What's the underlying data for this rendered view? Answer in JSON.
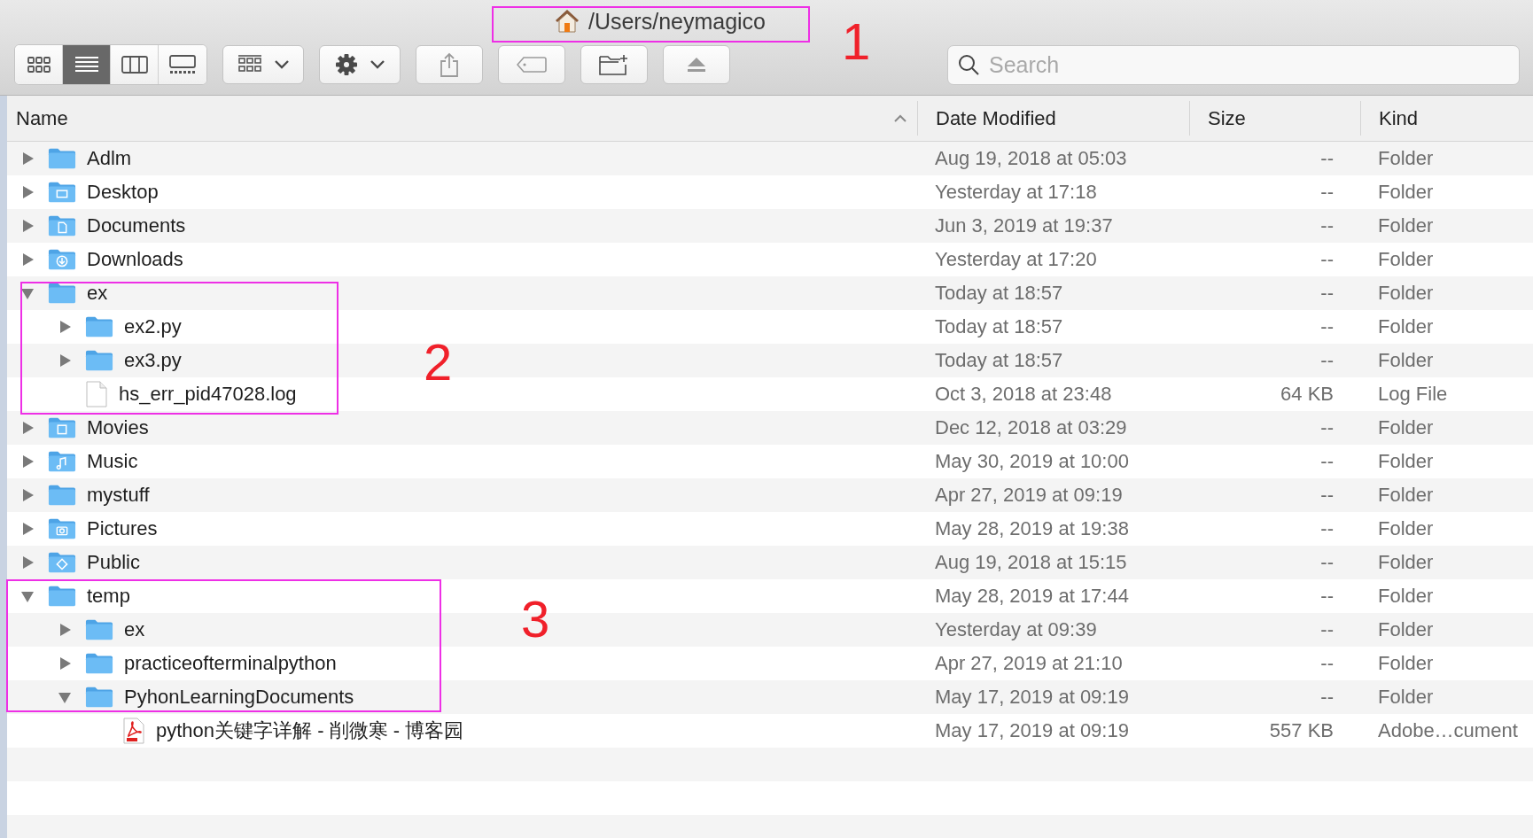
{
  "window": {
    "title": "/Users/neymagico"
  },
  "toolbar": {
    "view_modes": [
      {
        "kind": "icons",
        "selected": false
      },
      {
        "kind": "list",
        "selected": true
      },
      {
        "kind": "columns",
        "selected": false
      },
      {
        "kind": "gallery",
        "selected": false
      }
    ],
    "search": {
      "placeholder": "Search"
    }
  },
  "table": {
    "columns": [
      {
        "label": "Name",
        "sorted": true
      },
      {
        "label": "Date Modified",
        "sorted": false
      },
      {
        "label": "Size",
        "sorted": false
      },
      {
        "label": "Kind",
        "sorted": false
      }
    ],
    "rows": [
      {
        "name": "Adlm",
        "kind": "folder",
        "expanded": false,
        "date": "Aug 19, 2018 at 05:03",
        "size": "--",
        "type": "Folder"
      },
      {
        "name": "Desktop",
        "kind": "desktop",
        "expanded": false,
        "date": "Yesterday at 17:18",
        "size": "--",
        "type": "Folder"
      },
      {
        "name": "Documents",
        "kind": "documents",
        "expanded": false,
        "date": "Jun 3, 2019 at 19:37",
        "size": "--",
        "type": "Folder"
      },
      {
        "name": "Downloads",
        "kind": "downloads",
        "expanded": false,
        "date": "Yesterday at 17:20",
        "size": "--",
        "type": "Folder"
      },
      {
        "name": "ex",
        "kind": "folder",
        "expanded": true,
        "date": "Today at 18:57",
        "size": "--",
        "type": "Folder",
        "children": [
          {
            "name": "ex2.py",
            "kind": "folder",
            "expanded": false,
            "date": "Today at 18:57",
            "size": "--",
            "type": "Folder"
          },
          {
            "name": "ex3.py",
            "kind": "folder",
            "expanded": false,
            "date": "Today at 18:57",
            "size": "--",
            "type": "Folder"
          },
          {
            "name": "hs_err_pid47028.log",
            "kind": "file",
            "date": "Oct 3, 2018 at 23:48",
            "size": "64 KB",
            "type": "Log File"
          }
        ]
      },
      {
        "name": "Movies",
        "kind": "movies",
        "expanded": false,
        "date": "Dec 12, 2018 at 03:29",
        "size": "--",
        "type": "Folder"
      },
      {
        "name": "Music",
        "kind": "music",
        "expanded": false,
        "date": "May 30, 2019 at 10:00",
        "size": "--",
        "type": "Folder"
      },
      {
        "name": "mystuff",
        "kind": "folder",
        "expanded": false,
        "date": "Apr 27, 2019 at 09:19",
        "size": "--",
        "type": "Folder"
      },
      {
        "name": "Pictures",
        "kind": "pictures",
        "expanded": false,
        "date": "May 28, 2019 at 19:38",
        "size": "--",
        "type": "Folder"
      },
      {
        "name": "Public",
        "kind": "public",
        "expanded": false,
        "date": "Aug 19, 2018 at 15:15",
        "size": "--",
        "type": "Folder"
      },
      {
        "name": "temp",
        "kind": "folder",
        "expanded": true,
        "date": "May 28, 2019 at 17:44",
        "size": "--",
        "type": "Folder",
        "children": [
          {
            "name": "ex",
            "kind": "folder",
            "expanded": false,
            "date": "Yesterday at 09:39",
            "size": "--",
            "type": "Folder"
          },
          {
            "name": "practiceofterminalpython",
            "kind": "folder",
            "expanded": false,
            "date": "Apr 27, 2019 at 21:10",
            "size": "--",
            "type": "Folder"
          },
          {
            "name": "PyhonLearningDocuments",
            "kind": "folder",
            "expanded": true,
            "date": "May 17, 2019 at 09:19",
            "size": "--",
            "type": "Folder",
            "children": [
              {
                "name": "python关键字详解 - 削微寒 - 博客园",
                "kind": "pdf",
                "date": "May 17, 2019 at 09:19",
                "size": "557 KB",
                "type": "Adobe…cument"
              }
            ]
          }
        ]
      }
    ]
  },
  "annotations": [
    {
      "number": "1"
    },
    {
      "number": "2"
    },
    {
      "number": "3"
    }
  ]
}
